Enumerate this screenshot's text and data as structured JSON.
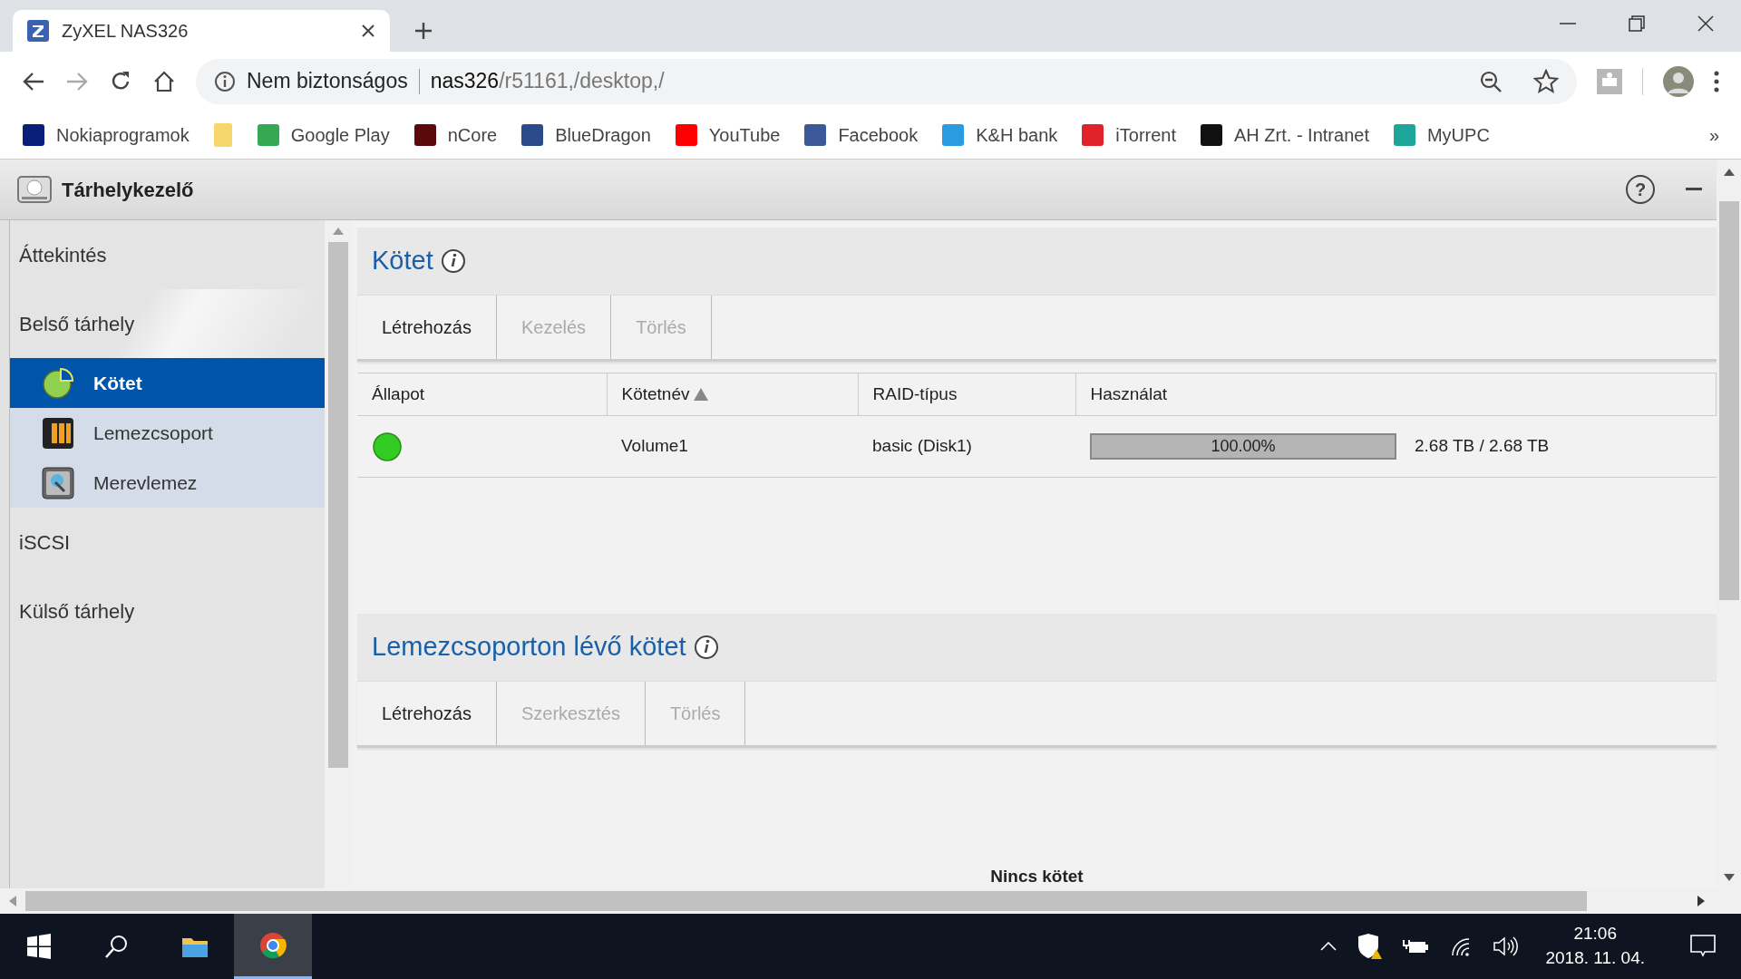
{
  "browser": {
    "tabs": [
      {
        "title": "ZyXEL NAS326",
        "selected": true
      }
    ],
    "address": {
      "security": "Nem biztonságos",
      "host": "nas326",
      "path": "/r51161,/desktop,/"
    },
    "bookmarks": [
      {
        "label": "Nokiaprogramok",
        "color": "#0a1f7a"
      },
      {
        "color": "#f7d66b"
      },
      {
        "label": "Google Play",
        "color": "#34a853"
      },
      {
        "label": "nCore",
        "color": "#5a0a0a"
      },
      {
        "label": "BlueDragon",
        "color": "#2a4a8a"
      },
      {
        "label": "YouTube",
        "color": "#ff0000"
      },
      {
        "label": "Facebook",
        "color": "#3b5998"
      },
      {
        "label": "K&H bank",
        "color": "#2b9be0"
      },
      {
        "label": "iTorrent",
        "color": "#e0232b"
      },
      {
        "label": "AH Zrt. - Intranet",
        "color": "#111111"
      },
      {
        "label": "MyUPC",
        "color": "#1ea59a"
      }
    ],
    "bookmarks_more": "»"
  },
  "app": {
    "title": "Tárhelykezelő",
    "help": "?",
    "sidebar": [
      {
        "label": "Áttekintés",
        "selected": false
      },
      {
        "label": "Belső tárhely",
        "selected": false,
        "children": [
          {
            "label": "Kötet",
            "kind": "volume",
            "selected": true
          },
          {
            "label": "Lemezcsoport",
            "kind": "group",
            "selected": false
          },
          {
            "label": "Merevlemez",
            "kind": "disk",
            "selected": false
          }
        ]
      },
      {
        "label": "iSCSI",
        "selected": false
      },
      {
        "label": "Külső tárhely",
        "selected": false
      }
    ],
    "sections": [
      {
        "title": "Kötet",
        "actions": [
          {
            "label": "Létrehozás",
            "disabled": false
          },
          {
            "label": "Kezelés",
            "disabled": true
          },
          {
            "label": "Törlés",
            "disabled": true
          }
        ],
        "table": {
          "columns": [
            {
              "label": "Állapot",
              "sorted": false
            },
            {
              "label": "Kötetnév",
              "sorted": true
            },
            {
              "label": "RAID-típus",
              "sorted": false
            },
            {
              "label": "Használat",
              "sorted": false
            }
          ],
          "rows": [
            {
              "color": "#33cc22",
              "name": "Volume1",
              "raid": "basic (Disk1)",
              "usage": {
                "level": 1.0,
                "reading": "100.00%"
              },
              "capacity": "2.68 TB / 2.68 TB"
            }
          ]
        }
      },
      {
        "title": "Lemezcsoporton lévő kötet",
        "actions": [
          {
            "label": "Létrehozás",
            "disabled": false
          },
          {
            "label": "Szerkesztés",
            "disabled": true
          },
          {
            "label": "Törlés",
            "disabled": true
          }
        ],
        "empty_text": "Nincs kötet"
      }
    ]
  },
  "taskbar": {
    "time": "21:06",
    "date": "2018. 11. 04."
  }
}
